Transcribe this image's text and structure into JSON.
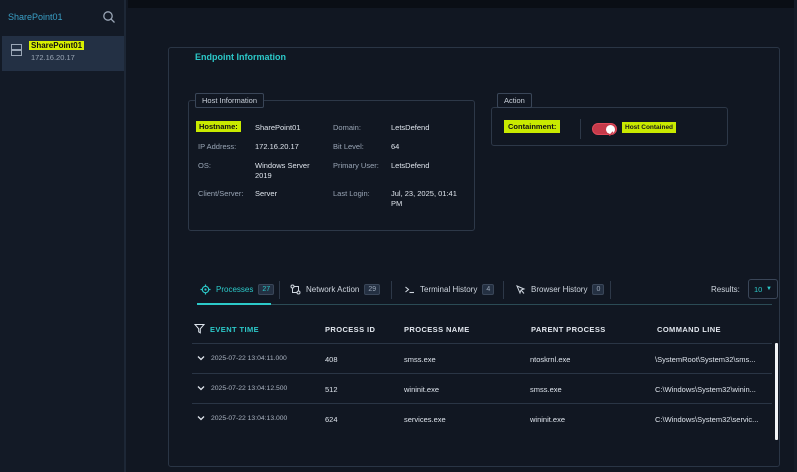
{
  "sidebar": {
    "search_value": "SharePoint01",
    "items": [
      {
        "name": "SharePoint01",
        "ip": "172.16.20.17"
      }
    ]
  },
  "endpoint": {
    "title": "Endpoint Information",
    "host_info": {
      "label": "Host Information",
      "fields": {
        "hostname_key": "Hostname:",
        "hostname_val": "SharePoint01",
        "ip_key": "IP Address:",
        "ip_val": "172.16.20.17",
        "os_key": "OS:",
        "os_val": "Windows Server 2019",
        "client_key": "Client/Server:",
        "client_val": "Server",
        "domain_key": "Domain:",
        "domain_val": "LetsDefend",
        "bit_key": "Bit Level:",
        "bit_val": "64",
        "user_key": "Primary User:",
        "user_val": "LetsDefend",
        "login_key": "Last Login:",
        "login_val": "Jul, 23, 2025, 01:41 PM"
      }
    },
    "action": {
      "label": "Action",
      "containment_key": "Containment:",
      "status": "Host Contained",
      "toggle_on": true
    }
  },
  "tabs": [
    {
      "label": "Processes",
      "count": "27",
      "active": true,
      "icon": "gear-icon"
    },
    {
      "label": "Network Action",
      "count": "29",
      "active": false,
      "icon": "network-icon"
    },
    {
      "label": "Terminal History",
      "count": "4",
      "active": false,
      "icon": "terminal-icon"
    },
    {
      "label": "Browser History",
      "count": "0",
      "active": false,
      "icon": "cursor-icon"
    }
  ],
  "results": {
    "label": "Results:",
    "value": "10"
  },
  "table": {
    "headers": {
      "time": "EVENT TIME",
      "pid": "PROCESS ID",
      "pname": "PROCESS NAME",
      "parent": "PARENT PROCESS",
      "cmd": "COMMAND LINE"
    },
    "rows": [
      {
        "time": "2025-07-22 13:04:11.000",
        "pid": "408",
        "pname": "smss.exe",
        "parent": "ntoskrnl.exe",
        "cmd": "\\SystemRoot\\System32\\sms..."
      },
      {
        "time": "2025-07-22 13:04:12.500",
        "pid": "512",
        "pname": "wininit.exe",
        "parent": "smss.exe",
        "cmd": "C:\\Windows\\System32\\winin..."
      },
      {
        "time": "2025-07-22 13:04:13.000",
        "pid": "624",
        "pname": "services.exe",
        "parent": "wininit.exe",
        "cmd": "C:\\Windows\\System32\\servic..."
      }
    ]
  },
  "colors": {
    "accent": "#2cc9c9",
    "highlight": "#c9ea00",
    "toggle": "#c63a4a",
    "background": "#111722"
  }
}
